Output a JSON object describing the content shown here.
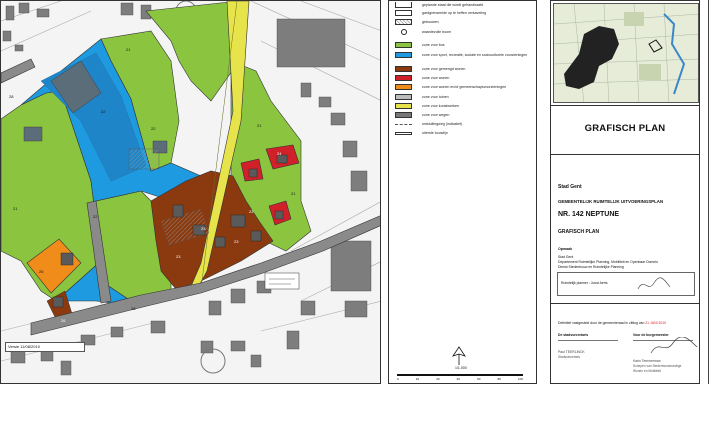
{
  "map": {
    "version_label": "Versie 11/08/2010",
    "zone_labels": [
      "21",
      "21",
      "21",
      "21",
      "22",
      "22",
      "22",
      "23",
      "23",
      "23",
      "23",
      "24",
      "25",
      "26",
      "28",
      "28"
    ]
  },
  "legend": {
    "items": [
      {
        "label": "geplande staat die wordt gehandhaafd",
        "color": "#ffffff",
        "kind": "partial"
      },
      {
        "label": "gardgrenseelde op te heffen verkaveling",
        "color": "#ffffff",
        "kind": "box"
      },
      {
        "label": "gebouwen",
        "color": "#d8d8d8",
        "kind": "hatch"
      },
      {
        "label": "waardevolle boom",
        "color": "#ffffff",
        "kind": "circle"
      },
      {
        "label": "zone voor bos",
        "color": "#8bc540",
        "kind": "box"
      },
      {
        "label": "zone voor sport, recreatie, sociale en socioculturele voorzieningen",
        "color": "#1e9ae0",
        "kind": "box"
      },
      {
        "label": "zone voor gemengd wonen",
        "color": "#8b3a0f",
        "kind": "box"
      },
      {
        "label": "zone voor wonen",
        "color": "#d0202a",
        "kind": "box"
      },
      {
        "label": "zone voor wonen en/of gemeenschapsvoorzieningen",
        "color": "#ef8c1a",
        "kind": "box"
      },
      {
        "label": "zone voor tuinen",
        "color": "#bdbdbd",
        "kind": "box"
      },
      {
        "label": "zone voor kunstwerken",
        "color": "#e7e34b",
        "kind": "box"
      },
      {
        "label": "zone voor wegen",
        "color": "#777777",
        "kind": "box"
      },
      {
        "label": "ontsluitingweg (indicatief)",
        "color": "#555555",
        "kind": "arrow"
      },
      {
        "label": "uiterste bouwlijn",
        "color": "#ffffff",
        "kind": "line"
      }
    ],
    "scale_label": "1/1.000",
    "scale_ticks": [
      "0",
      "10",
      "20",
      "40",
      "60",
      "80",
      "100"
    ]
  },
  "panel": {
    "section_title": "GRAFISCH PLAN",
    "city": "Stad Gent",
    "plan_type": "GEMEENTELIJK RUIMTELIJK UITVOERINGSPLAN",
    "plan_number": "NR. 142  NEPTUNE",
    "plan_subtitle": "GRAFISCH PLAN",
    "opmaak_heading": "Opmaak",
    "opmaak_org": "Stad Gent",
    "opmaak_dept": "Departement Ruimtelijke Planning, Mobiliteit en Openbaar Domein",
    "opmaak_service": "Dienst Stedenbouw en Ruimtelijke Planning",
    "planner_label": "Ruimtelijk planner : Joost Aerts",
    "adoption_statement": "Definitief vastgesteld door de gemeenteraad in zitting van",
    "adoption_date": "21 JUNI 2010",
    "secretary_heading": "De stadssecretaris",
    "mayor_heading": "Voor de burgemeester",
    "secretary_name": "Paul TEERLINCK",
    "secretary_title": "Stadssecretaris",
    "alderman_name": "Karin Temmerman",
    "alderman_title": "Schepen van Stedenbouwkundige",
    "alderman_title2": "Wonen en Mobiliteit"
  },
  "colors": {
    "forest": "#8bc540",
    "sport": "#1e9ae0",
    "mixed": "#8b3a0f",
    "housing": "#d0202a",
    "community": "#ef8c1a",
    "art": "#e7e34b",
    "road": "#777777",
    "deadline": "#d0202a"
  }
}
